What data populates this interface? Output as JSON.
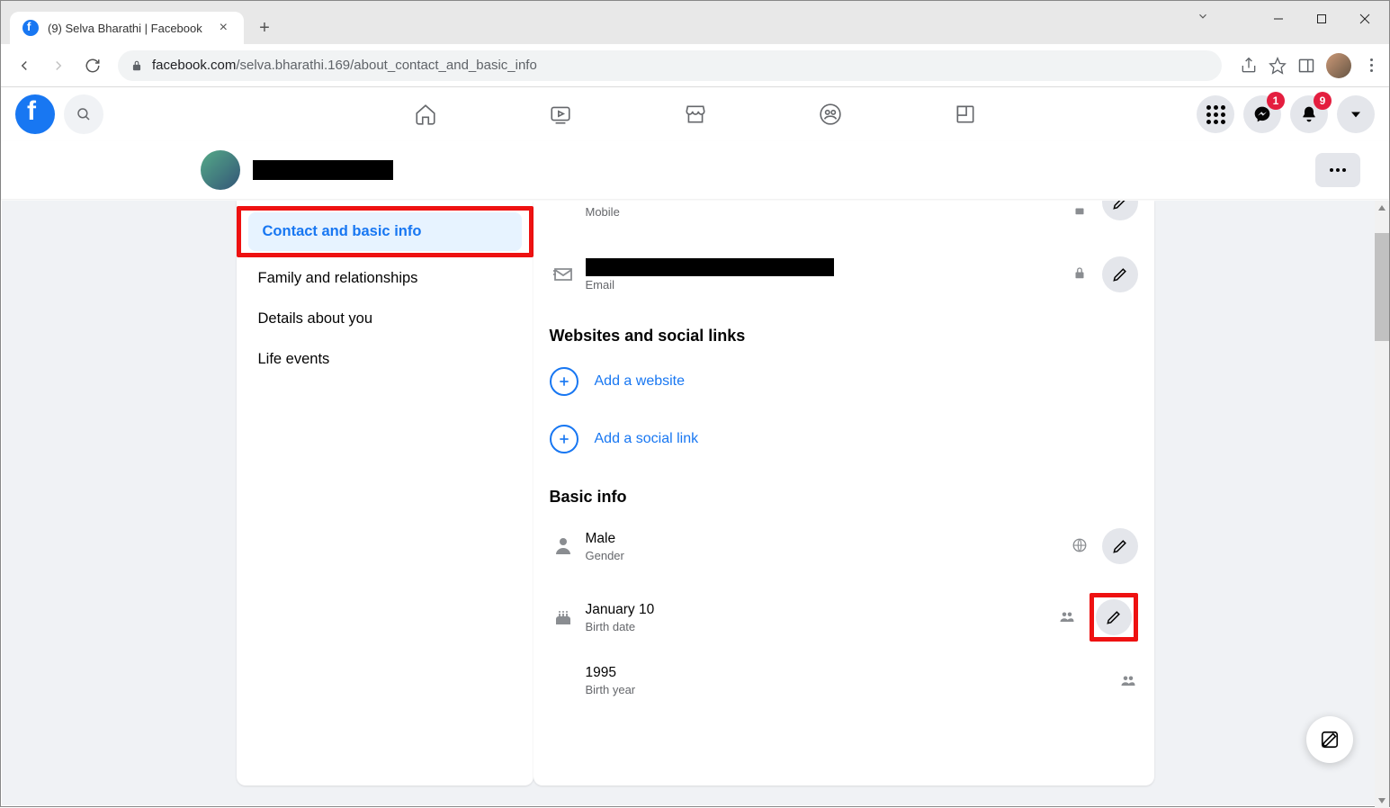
{
  "browser": {
    "tab_title": "(9) Selva Bharathi | Facebook",
    "url_domain": "facebook.com",
    "url_path": "/selva.bharathi.169/about_contact_and_basic_info"
  },
  "fb_header": {
    "messenger_badge": "1",
    "notifications_badge": "9"
  },
  "sidebar": {
    "items": [
      {
        "label": "Contact and basic info",
        "active": true
      },
      {
        "label": "Family and relationships",
        "active": false
      },
      {
        "label": "Details about you",
        "active": false
      },
      {
        "label": "Life events",
        "active": false
      }
    ]
  },
  "main": {
    "mobile_label": "Mobile",
    "email_label": "Email",
    "section_websites": "Websites and social links",
    "add_website": "Add a website",
    "add_social": "Add a social link",
    "section_basic": "Basic info",
    "gender_value": "Male",
    "gender_label": "Gender",
    "birthdate_value": "January 10",
    "birthdate_label": "Birth date",
    "birthyear_value": "1995",
    "birthyear_label": "Birth year"
  }
}
